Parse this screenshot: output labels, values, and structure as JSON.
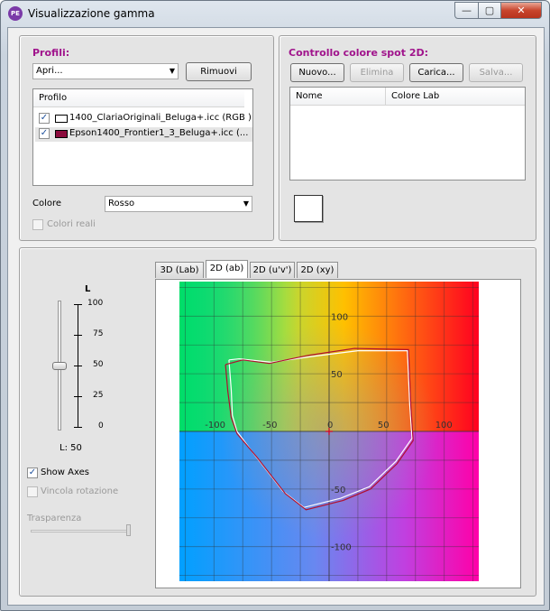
{
  "window": {
    "title": "Visualizzazione gamma",
    "app_icon": "PE",
    "controls": {
      "minimize": "—",
      "maximize": "▢",
      "close": "✕"
    }
  },
  "profiles": {
    "title": "Profili:",
    "open_combo": "Apri...",
    "remove_button": "Rimuovi",
    "list_header": "Profilo",
    "items": [
      {
        "name": "1400_ClariaOriginali_Beluga+.icc (RGB )",
        "checked": true,
        "swatch": "#ffffff"
      },
      {
        "name": "Epson1400_Frontier1_3_Beluga+.icc (...",
        "checked": true,
        "swatch": "#8b0a3c"
      }
    ],
    "color_label": "Colore",
    "color_value": "Rosso",
    "real_colors_label": "Colori reali",
    "check_mark": "✓"
  },
  "spot": {
    "title": "Controllo colore spot 2D:",
    "new_button": "Nuovo...",
    "delete_button": "Elimina",
    "load_button": "Carica...",
    "save_button": "Salva...",
    "col_name": "Nome",
    "col_lab": "Colore Lab"
  },
  "view": {
    "tabs": [
      "3D (Lab)",
      "2D (ab)",
      "2D (u'v')",
      "2D (xy)"
    ],
    "active_tab": 1,
    "slider_title": "L",
    "slider_ticks": [
      "100",
      "75",
      "50",
      "25",
      "0"
    ],
    "slider_value": 50,
    "l_readout": "L: 50",
    "show_axes_label": "Show Axes",
    "lock_rotation_label": "Vincola rotazione",
    "transparency_label": "Trasparenza"
  },
  "chart_data": {
    "type": "scatter",
    "xlim": [
      -130,
      130
    ],
    "ylim": [
      -130,
      130
    ],
    "grid": true,
    "x_tick_labels": [
      "-100",
      "-50",
      "0",
      "50",
      "100"
    ],
    "y_tick_labels": [
      "100",
      "50",
      "-50",
      "-100"
    ],
    "series": [
      {
        "color": "#ffffff",
        "points": [
          [
            -87,
            62
          ],
          [
            -85,
            36
          ],
          [
            -84,
            14
          ],
          [
            -80,
            0
          ],
          [
            -65,
            -20
          ],
          [
            -40,
            -52
          ],
          [
            -22,
            -66
          ],
          [
            10,
            -58
          ],
          [
            35,
            -48
          ],
          [
            58,
            -26
          ],
          [
            72,
            -6
          ],
          [
            70,
            24
          ],
          [
            68,
            70
          ],
          [
            25,
            70
          ],
          [
            -15,
            65
          ],
          [
            -50,
            60
          ],
          [
            -78,
            63
          ],
          [
            -87,
            62
          ]
        ]
      },
      {
        "color": "#b01030",
        "points": [
          [
            -90,
            58
          ],
          [
            -88,
            35
          ],
          [
            -85,
            12
          ],
          [
            -80,
            -2
          ],
          [
            -63,
            -22
          ],
          [
            -38,
            -54
          ],
          [
            -20,
            -68
          ],
          [
            12,
            -60
          ],
          [
            36,
            -50
          ],
          [
            59,
            -28
          ],
          [
            73,
            -8
          ],
          [
            71,
            22
          ],
          [
            69,
            71
          ],
          [
            22,
            72
          ],
          [
            -18,
            66
          ],
          [
            -52,
            59
          ],
          [
            -75,
            62
          ],
          [
            -90,
            58
          ]
        ]
      }
    ],
    "center_marker": [
      0,
      0
    ]
  }
}
